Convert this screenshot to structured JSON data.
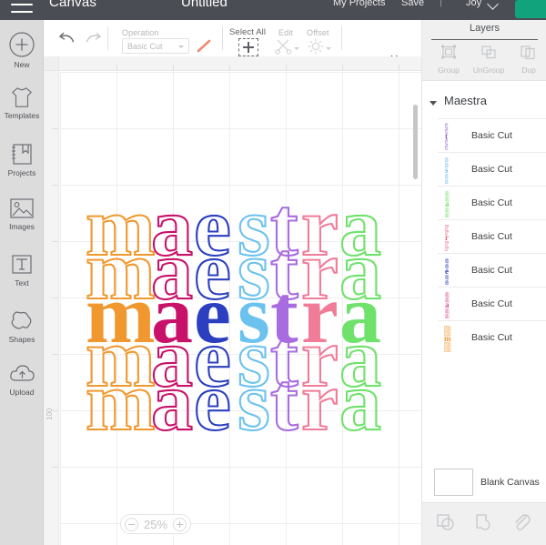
{
  "topbar": {
    "menu_icon": "hamburger-icon",
    "canvas_label": "Canvas",
    "document_title": "Untitled",
    "my_projects": "My Projects",
    "save": "Save",
    "divider": "|",
    "account_name": "Joy",
    "chevron_icon": "chevron-down-icon",
    "primary_button_color": "#11a37b",
    "background_color": "#4b4d54"
  },
  "sidebar": {
    "items": [
      {
        "label": "New",
        "icon": "plus-circle-icon"
      },
      {
        "label": "Templates",
        "icon": "tshirt-icon"
      },
      {
        "label": "Projects",
        "icon": "notebook-icon"
      },
      {
        "label": "Images",
        "icon": "picture-icon"
      },
      {
        "label": "Text",
        "icon": "text-t-icon"
      },
      {
        "label": "Shapes",
        "icon": "shapes-icon"
      },
      {
        "label": "Upload",
        "icon": "cloud-upload-icon"
      }
    ]
  },
  "toolbar": {
    "undo_icon": "undo-arrow-icon",
    "redo_icon": "redo-arrow-icon",
    "operation_label": "Operation",
    "operation_value": "Basic Cut",
    "operation_color_icon": "line-color-swatch",
    "select_all_label": "Select All",
    "select_all_icon": "select-all-icon",
    "edit_label": "Edit",
    "edit_icon": "scissors-icon",
    "offset_label": "Offset",
    "offset_icon": "offset-sun-icon",
    "more_label": "More"
  },
  "canvas": {
    "ruler_label": "100",
    "zoom_level": "25%",
    "zoom_out_icon": "minus-circle-icon",
    "zoom_in_icon": "plus-circle-icon",
    "scrollbar": "vertical-scrollbar"
  },
  "artwork": {
    "word": "maestra",
    "style": "stacked-repeat-word-art",
    "rows": 5,
    "solid_row_index": 2,
    "letters": [
      {
        "char": "m",
        "color": "#F0982F"
      },
      {
        "char": "a",
        "color": "#C8126A"
      },
      {
        "char": "e",
        "color": "#2B3FC0"
      },
      {
        "char": "s",
        "color": "#6BC2EE"
      },
      {
        "char": "t",
        "color": "#A86CE0"
      },
      {
        "char": "r",
        "color": "#F07C9A"
      },
      {
        "char": "a",
        "color": "#6FE26B"
      }
    ]
  },
  "layers": {
    "tab_label": "Layers",
    "ops": [
      {
        "label": "Group",
        "icon": "group-icon"
      },
      {
        "label": "UnGroup",
        "icon": "ungroup-icon"
      },
      {
        "label": "Dup",
        "icon": "duplicate-icon"
      }
    ],
    "group": {
      "name": "Maestra",
      "expand_icon": "triangle-down-icon"
    },
    "rows": [
      {
        "name": "Basic Cut",
        "color": "#8B5EC8"
      },
      {
        "name": "Basic Cut",
        "color": "#6BC2EE"
      },
      {
        "name": "Basic Cut",
        "color": "#6FE26B"
      },
      {
        "name": "Basic Cut",
        "color": "#E8607F"
      },
      {
        "name": "Basic Cut",
        "color": "#2B3FC0"
      },
      {
        "name": "Basic Cut",
        "color": "#D94B8E"
      },
      {
        "name": "Basic Cut",
        "color": "#F0982F"
      }
    ],
    "blank_canvas": {
      "label": "Blank Canvas",
      "swatch_color": "#ffffff"
    },
    "bottom_tools": [
      {
        "icon": "slice-icon"
      },
      {
        "icon": "weld-icon"
      },
      {
        "icon": "attach-icon"
      }
    ]
  }
}
